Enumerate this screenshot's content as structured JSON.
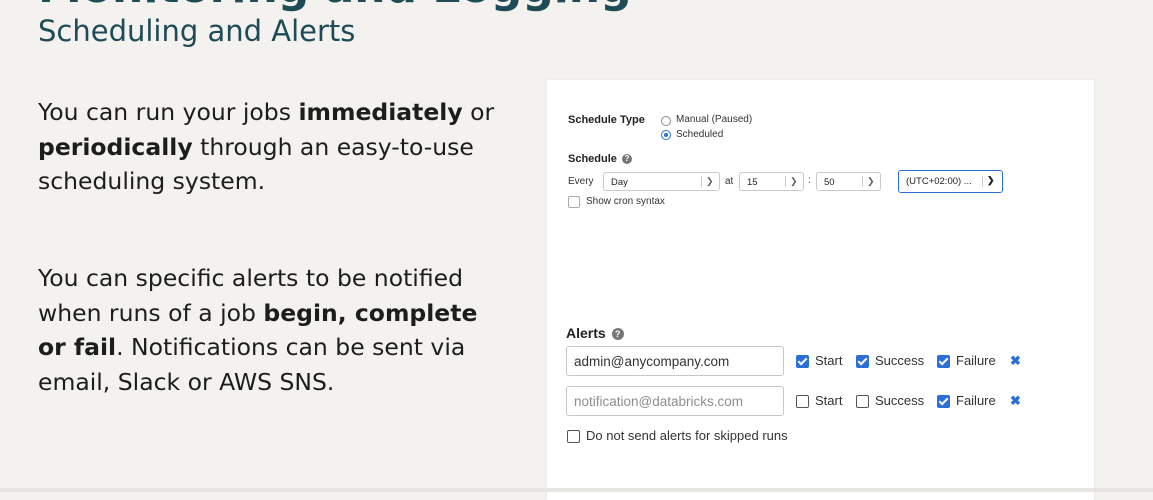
{
  "slide": {
    "heading_cut": "Monitoring and Logging",
    "subtitle": "Scheduling and Alerts",
    "para1": {
      "t1": "You can run your jobs ",
      "b1": "immediately",
      "t2": " or ",
      "b2": "periodically",
      "t3": " through an easy-to-use scheduling system."
    },
    "para2": {
      "t1": "You can specific alerts to be notified when runs of a job ",
      "b1": "begin, complete or fail",
      "t2": ". Notifications can be sent via email, Slack or AWS SNS."
    }
  },
  "panel": {
    "schedule_type_label": "Schedule Type",
    "schedule_options": [
      {
        "label": "Manual (Paused)",
        "selected": false
      },
      {
        "label": "Scheduled",
        "selected": true
      }
    ],
    "schedule_label": "Schedule",
    "every_label": "Every",
    "period_value": "Day",
    "at_label": "at",
    "hour_value": "15",
    "colon": ":",
    "minute_value": "50",
    "timezone_value": "(UTC+02:00) ...",
    "show_cron_label": "Show cron syntax",
    "alerts_label": "Alerts",
    "alerts": [
      {
        "email": "admin@anycompany.com",
        "placeholder": false,
        "start": true,
        "success": true,
        "failure": true
      },
      {
        "email": "notification@databricks.com",
        "placeholder": true,
        "start": false,
        "success": false,
        "failure": true
      }
    ],
    "start_label": "Start",
    "success_label": "Success",
    "failure_label": "Failure",
    "remove_glyph": "✖",
    "skip_label": "Do not send alerts for skipped runs",
    "accent_color": "#2b6fd6"
  }
}
